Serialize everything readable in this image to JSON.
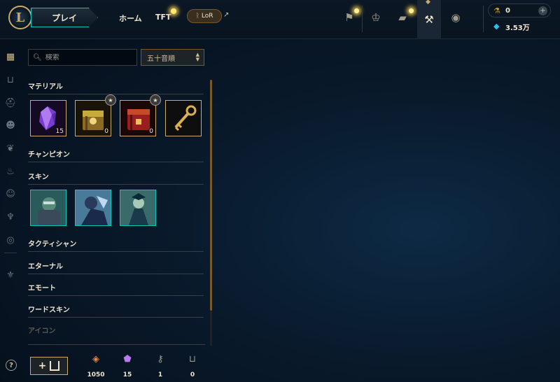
{
  "header": {
    "play_label": "プレイ",
    "nav": {
      "home": "ホーム",
      "tft": "TFT",
      "lor": "LoR"
    },
    "currencies": {
      "blue_essence": "0",
      "rp": "3.53万"
    }
  },
  "inventory": {
    "search_placeholder": "検索",
    "sort_value": "五十音順",
    "sections": {
      "materials": "マテリアル",
      "champions": "チャンピオン",
      "skins": "スキン",
      "tacticians": "タクティシャン",
      "eternals": "エターナル",
      "emotes": "エモート",
      "ward_skins": "ワードスキン",
      "icons": "アイコン"
    },
    "materials": [
      {
        "name": "orange-essence-gem",
        "count": "15",
        "icon": "purple-gem"
      },
      {
        "name": "champion-chest",
        "count": "0",
        "icon": "gold-chest"
      },
      {
        "name": "masterwork-chest",
        "count": "0",
        "icon": "red-chest"
      },
      {
        "name": "hextech-key",
        "count": "",
        "icon": "gold-key"
      }
    ],
    "skins_count": 3
  },
  "footer": {
    "wallet": [
      {
        "icon": "orange-essence-icon",
        "value": "1050",
        "color": "#e8884a"
      },
      {
        "icon": "mythic-essence-icon",
        "value": "15",
        "color": "#b67cf0"
      },
      {
        "icon": "key-fragment-icon",
        "value": "1",
        "color": "#a09b8c"
      },
      {
        "icon": "chest-icon",
        "value": "0",
        "color": "#a09b8c"
      }
    ]
  },
  "colors": {
    "gold": "#c8aa6e",
    "teal": "#0ac8b9",
    "text": "#f0e6d2"
  }
}
